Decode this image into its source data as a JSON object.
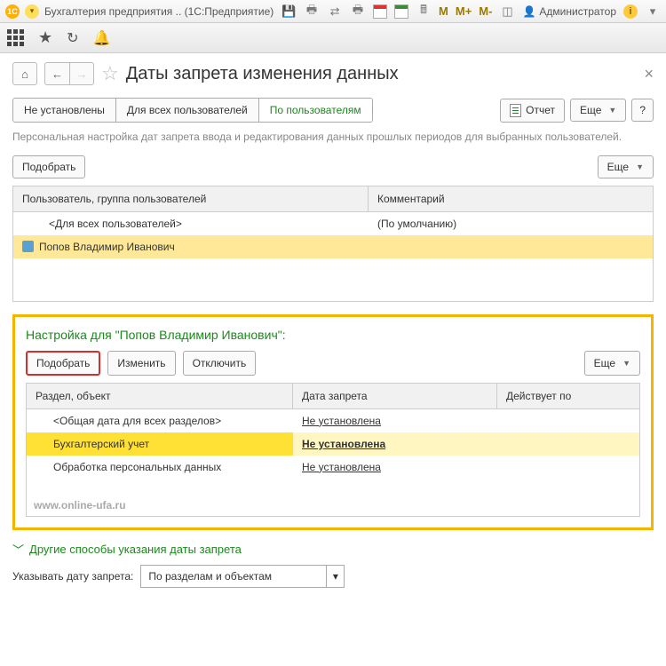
{
  "titlebar": {
    "logo_text": "1C",
    "title": "Бухгалтерия предприятия .. (1С:Предприятие)",
    "m_labels": [
      "M",
      "M+",
      "M-"
    ],
    "admin_label": "Администратор"
  },
  "header": {
    "page_title": "Даты запрета изменения данных"
  },
  "tabs": {
    "t1": "Не установлены",
    "t2": "Для всех пользователей",
    "t3": "По пользователям"
  },
  "toolbar": {
    "report": "Отчет",
    "more": "Еще",
    "help": "?"
  },
  "helptext": "Персональная настройка дат запрета ввода и редактирования данных прошлых периодов для выбранных пользователей.",
  "users_block": {
    "select_btn": "Подобрать",
    "more": "Еще",
    "col_user": "Пользователь, группа пользователей",
    "col_comment": "Комментарий",
    "rows": [
      {
        "user": "<Для всех пользователей>",
        "comment": "(По умолчанию)",
        "selected": false
      },
      {
        "user": "Попов Владимир Иванович",
        "comment": "",
        "selected": true
      }
    ]
  },
  "settings_block": {
    "title": "Настройка для \"Попов Владимир Иванович\":",
    "btn_select": "Подобрать",
    "btn_edit": "Изменить",
    "btn_off": "Отключить",
    "more": "Еще",
    "col_section": "Раздел, объект",
    "col_date": "Дата запрета",
    "col_until": "Действует по",
    "rows": [
      {
        "section": "<Общая дата для всех разделов>",
        "date": "Не установлена",
        "until": "",
        "sel": false
      },
      {
        "section": "Бухгалтерский учет",
        "date": "Не установлена",
        "until": "",
        "sel": true
      },
      {
        "section": "Обработка персональных данных",
        "date": "Не установлена",
        "until": "",
        "sel": false
      }
    ],
    "watermark": "www.online-ufa.ru"
  },
  "collapse": {
    "title": "Другие способы указания даты запрета",
    "field_label": "Указывать дату запрета:",
    "field_value": "По разделам и объектам"
  }
}
